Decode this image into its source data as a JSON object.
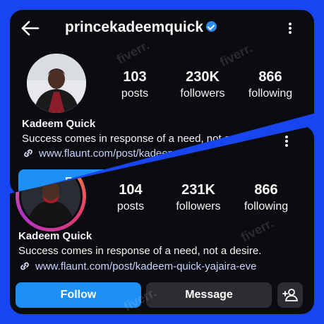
{
  "colors": {
    "background": "#1746f0",
    "panel": "#0b0c10",
    "accent_button": "#1e90f5",
    "secondary_button": "#2b2d31",
    "verified_badge": "#2a8cf0",
    "story_ring": "#f59b2b"
  },
  "top_profile": {
    "username": "princekadeemquick",
    "back_icon": "arrow-left-icon",
    "menu_icon": "more-vertical-icon",
    "stats": [
      {
        "value": "103",
        "label": "posts"
      },
      {
        "value": "230K",
        "label": "followers"
      },
      {
        "value": "866",
        "label": "following"
      }
    ],
    "name": "Kadeem Quick",
    "bio": "Success comes in response of a need, not a",
    "link": "www.flaunt.com/post/kadeem",
    "follow_label": "Follo"
  },
  "bottom_profile": {
    "menu_icon": "more-vertical-icon",
    "stats": [
      {
        "value": "104",
        "label": "posts"
      },
      {
        "value": "231K",
        "label": "followers"
      },
      {
        "value": "866",
        "label": "following"
      }
    ],
    "name": "Kadeem Quick",
    "bio": "Success comes in response of a need, not a desire.",
    "link": "www.flaunt.com/post/kadeem-quick-yajaira-eve",
    "follow_label": "Follow",
    "message_label": "Message",
    "add_person_icon": "add-person-icon"
  },
  "watermark": "fiverr."
}
